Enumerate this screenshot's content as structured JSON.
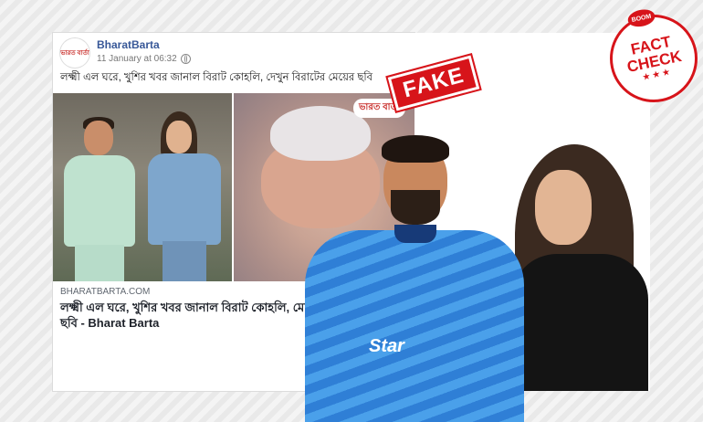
{
  "post": {
    "page_name": "BharatBarta",
    "timestamp": "11 January at 06:32",
    "avatar_text": "ভারত বার্তা",
    "text": "লক্ষ্মী এল ঘরে, খুশির খবর জানাল বিরাট কোহলি, দেখুন বিরাটের মেয়ের ছবি",
    "image_watermark": "ভারত বার্তা",
    "link_domain": "BHARATBARTA.COM",
    "link_title": "লক্ষ্মী এল ঘরে, খুশির খবর জানাল বিরাট কোহলি, মেয়ের ছবি - Bharat Barta"
  },
  "overlay": {
    "fake_label": "FAKE",
    "jersey_text": "Star",
    "badge_top": "BOOM",
    "badge_line1": "FACT",
    "badge_line2": "CHECK",
    "badge_stars": "★★★"
  },
  "colors": {
    "link": "#385898",
    "accent_red": "#d7141a",
    "jersey_blue": "#2f7fd6"
  },
  "icons": {
    "privacy": "globe-icon"
  }
}
